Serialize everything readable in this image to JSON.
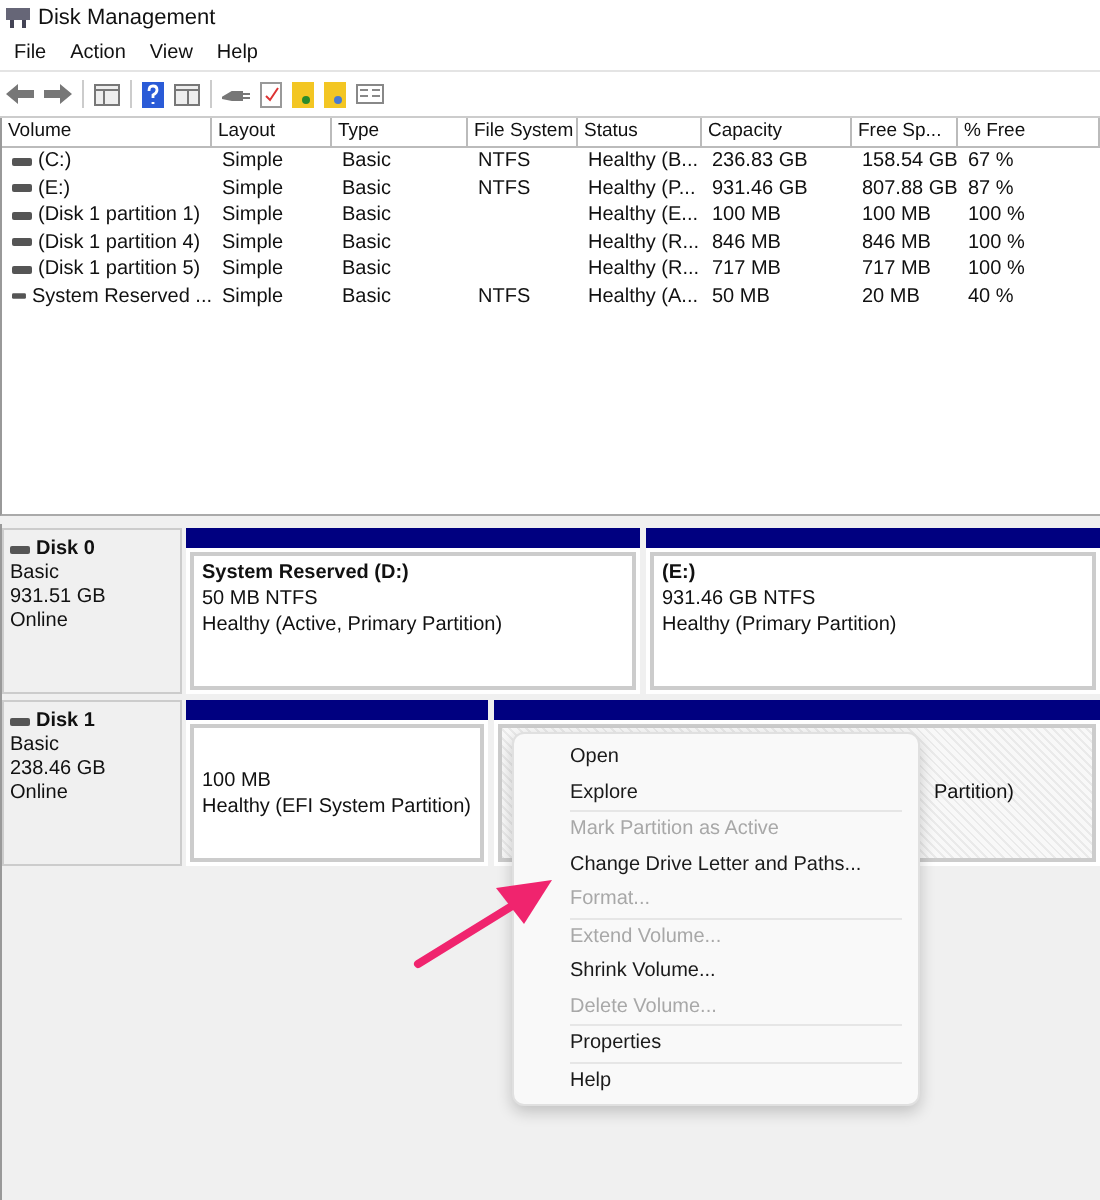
{
  "window": {
    "title": "Disk Management"
  },
  "menu": [
    "File",
    "Action",
    "View",
    "Help"
  ],
  "table": {
    "columns": [
      "Volume",
      "Layout",
      "Type",
      "File System",
      "Status",
      "Capacity",
      "Free Sp...",
      "% Free"
    ],
    "rows": [
      [
        "(C:)",
        "Simple",
        "Basic",
        "NTFS",
        "Healthy (B...",
        "236.83 GB",
        "158.54 GB",
        "67 %"
      ],
      [
        "(E:)",
        "Simple",
        "Basic",
        "NTFS",
        "Healthy (P...",
        "931.46 GB",
        "807.88 GB",
        "87 %"
      ],
      [
        "(Disk 1 partition 1)",
        "Simple",
        "Basic",
        "",
        "Healthy (E...",
        "100 MB",
        "100 MB",
        "100 %"
      ],
      [
        "(Disk 1 partition 4)",
        "Simple",
        "Basic",
        "",
        "Healthy (R...",
        "846 MB",
        "846 MB",
        "100 %"
      ],
      [
        "(Disk 1 partition 5)",
        "Simple",
        "Basic",
        "",
        "Healthy (R...",
        "717 MB",
        "717 MB",
        "100 %"
      ],
      [
        "System Reserved ...",
        "Simple",
        "Basic",
        "NTFS",
        "Healthy (A...",
        "50 MB",
        "20 MB",
        "40 %"
      ]
    ]
  },
  "disks": [
    {
      "name": "Disk 0",
      "type": "Basic",
      "size": "931.51 GB",
      "state": "Online",
      "partitions": [
        {
          "title": "System Reserved  (D:)",
          "size": "50 MB NTFS",
          "status": "Healthy (Active, Primary Partition)",
          "selected": false
        },
        {
          "title": "(E:)",
          "size": "931.46 GB NTFS",
          "status": "Healthy (Primary Partition)",
          "selected": false
        }
      ]
    },
    {
      "name": "Disk 1",
      "type": "Basic",
      "size": "238.46 GB",
      "state": "Online",
      "partitions": [
        {
          "size": "100 MB",
          "status": "Healthy (EFI System Partition)",
          "selected": false
        },
        {
          "status_tail": "Partition)",
          "selected": true
        }
      ]
    }
  ],
  "context_menu": [
    {
      "kind": "item",
      "label": "Open",
      "disabled": false
    },
    {
      "kind": "item",
      "label": "Explore",
      "disabled": false
    },
    {
      "kind": "separator"
    },
    {
      "kind": "item",
      "label": "Mark Partition as Active",
      "disabled": true
    },
    {
      "kind": "item",
      "label": "Change Drive Letter and Paths...",
      "disabled": false
    },
    {
      "kind": "item",
      "label": "Format...",
      "disabled": true
    },
    {
      "kind": "separator"
    },
    {
      "kind": "item",
      "label": "Extend Volume...",
      "disabled": true
    },
    {
      "kind": "item",
      "label": "Shrink Volume...",
      "disabled": false
    },
    {
      "kind": "item",
      "label": "Delete Volume...",
      "disabled": true
    },
    {
      "kind": "separator"
    },
    {
      "kind": "item",
      "label": "Properties",
      "disabled": false
    },
    {
      "kind": "separator"
    },
    {
      "kind": "item",
      "label": "Help",
      "disabled": false
    }
  ]
}
